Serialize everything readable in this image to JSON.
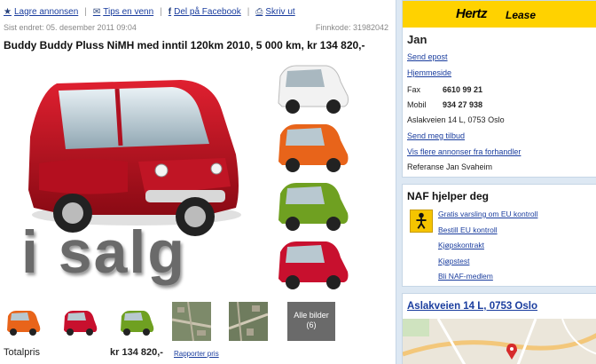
{
  "toolbar": {
    "save": "Lagre annonsen",
    "tips": "Tips en venn",
    "facebook": "Del på Facebook",
    "print": "Skriv ut"
  },
  "meta": {
    "last_modified": "Sist endret: 05. desember 2011 09:04",
    "finn_code": "Finnkode: 31982042"
  },
  "ad": {
    "title": "Buddy Buddy Pluss NiMH med inntil 120km 2010, 5 000 km, kr 134 820,-",
    "sale_text": "i salg",
    "all_images": "Alle bilder",
    "all_images_count": "(6)",
    "price_label": "Totalpris",
    "price_value": "kr 134 820,-",
    "report_price": "Rapporter pris"
  },
  "dealer": {
    "brand": "Hertz",
    "brand_sub": "Lease",
    "name": "Jan",
    "send_email": "Send epost",
    "homepage": "Hjemmeside",
    "fax_label": "Fax",
    "fax": "6610 99 21",
    "mobile_label": "Mobil",
    "mobile": "934 27 938",
    "address": "Aslakveien 14 L, 0753 Oslo",
    "send_offer": "Send meg tilbud",
    "more_ads": "Vis flere annonser fra forhandler",
    "reference": "Referanse Jan Svaheim"
  },
  "naf": {
    "title": "NAF hjelper deg",
    "links": [
      "Gratis varsling om EU kontroll",
      "Bestill EU kontroll",
      "Kjøpskontrakt",
      "Kjøpstest",
      "Bli NAF-medlem"
    ]
  },
  "map": {
    "title": "Aslakveien 14 L, 0753 Oslo"
  },
  "colors": {
    "link": "#1a3d9e",
    "sidebar_bg": "#dde8f3",
    "hertz_yellow": "#ffd200",
    "car_red": "#c8102e",
    "car_orange": "#e8641a",
    "car_green": "#6fa021",
    "car_white": "#f2f2f2"
  }
}
